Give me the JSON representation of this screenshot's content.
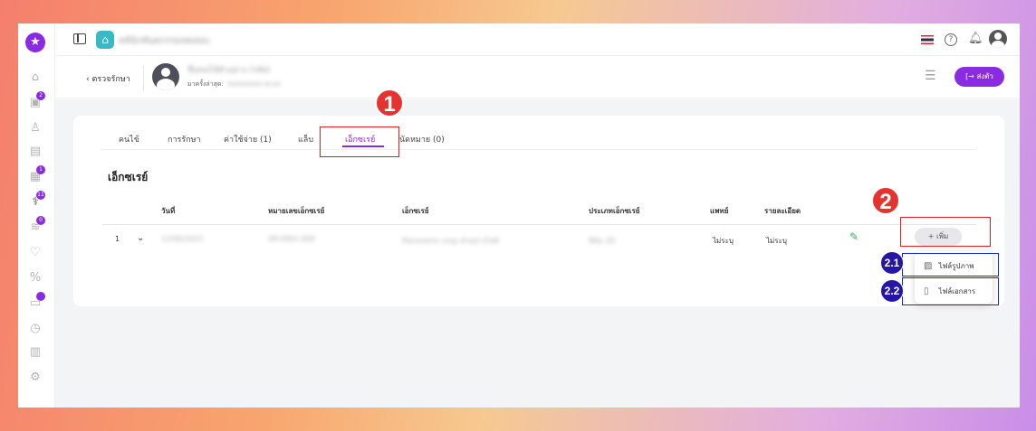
{
  "topbar": {
    "clinic_name": "คลินิกทันตกรรมทดสอบ"
  },
  "patientbar": {
    "back_label": "ตรวจรักษา",
    "patient_name": "ชื่อคนไข้ตัวอย่าง (รหัส)",
    "last_visit_label": "มาครั้งล่าสุด:",
    "last_visit_value": "xx/xx/xxxx xx:xx",
    "send_label": "ส่งตัว"
  },
  "sidebar": {
    "badges": [
      "2",
      "1",
      "11",
      "0"
    ]
  },
  "tabs": [
    "คนไข้",
    "การรักษา",
    "ค่าใช้จ่าย (1)",
    "แล็บ",
    "เอ็กซเรย์",
    "นัดหมาย (0)"
  ],
  "section_title": "เอ็กซเรย์",
  "table": {
    "headers": [
      "วันที่",
      "หมายเลขเอ็กซเรย์",
      "เอ็กซเรย์",
      "ประเภทเอ็กซเรย์",
      "แพทย์",
      "รายละเอียด"
    ],
    "row": {
      "index": "1",
      "date": "12/06/2023",
      "xray_no": "XR-0001-000",
      "xray": "Panoramic xray ตัวอย่างไฟล์",
      "xray_type": "ฟิล์ม 2D",
      "doctor": "ไม่ระบุ",
      "detail": "ไม่ระบุ"
    },
    "add_label": "เพิ่ม"
  },
  "dropdown": {
    "image_file": "ไฟล์รูปภาพ",
    "document_file": "ไฟล์เอกสาร"
  },
  "annotations": {
    "step1": "1",
    "step2": "2",
    "step2_1": "2.1",
    "step2_2": "2.2"
  },
  "colors": {
    "accent": "#8a2be2",
    "annotation_red": "#e53330",
    "annotation_blue": "#2616a8"
  }
}
